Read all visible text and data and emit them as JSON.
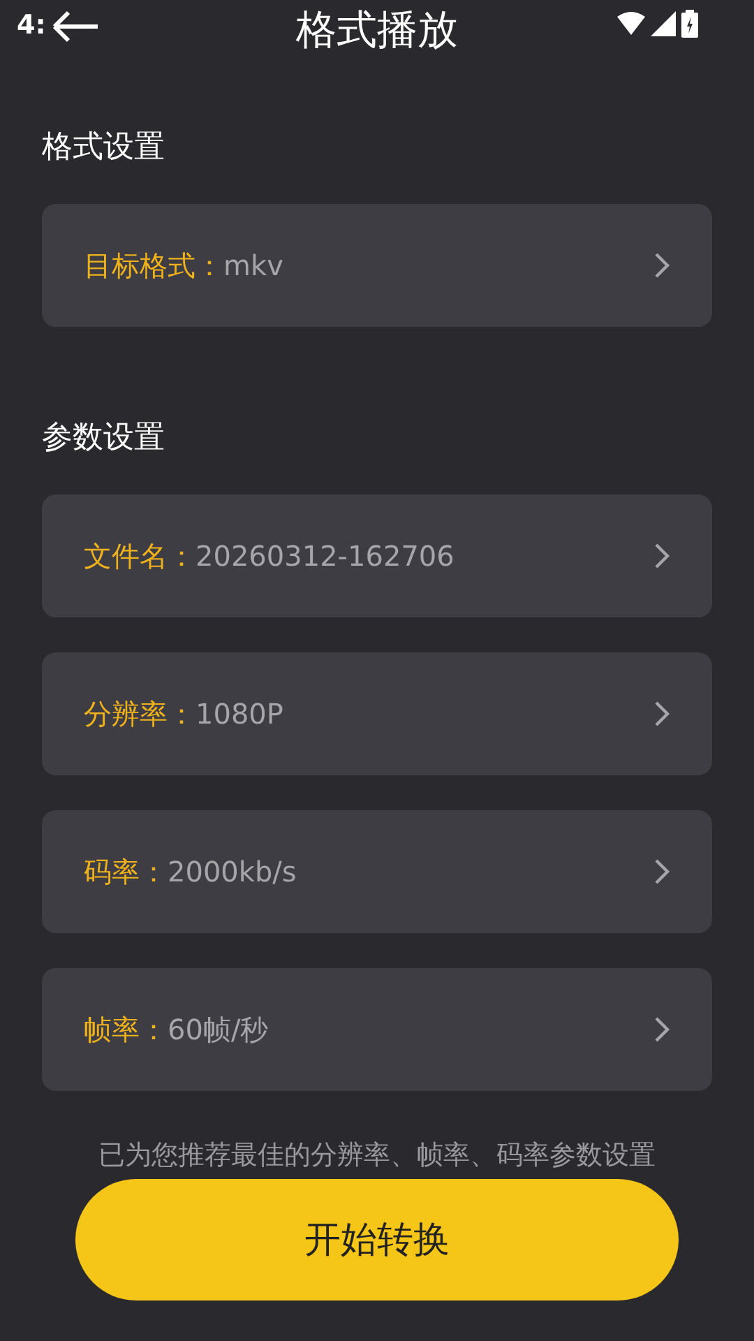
{
  "status_bar": {
    "time": "4:"
  },
  "header": {
    "title": "格式播放"
  },
  "sections": [
    {
      "title": "格式设置",
      "items": [
        {
          "label": "目标格式：",
          "value": "mkv"
        }
      ]
    },
    {
      "title": "参数设置",
      "items": [
        {
          "label": "文件名：",
          "value": "20260312-162706"
        },
        {
          "label": "分辨率：",
          "value": "1080P"
        },
        {
          "label": "码率：",
          "value": "2000kb/s"
        },
        {
          "label": "帧率：",
          "value": "60帧/秒"
        }
      ]
    }
  ],
  "hint": "已为您推荐最佳的分辨率、帧率、码率参数设置",
  "start_button": "开始转换"
}
